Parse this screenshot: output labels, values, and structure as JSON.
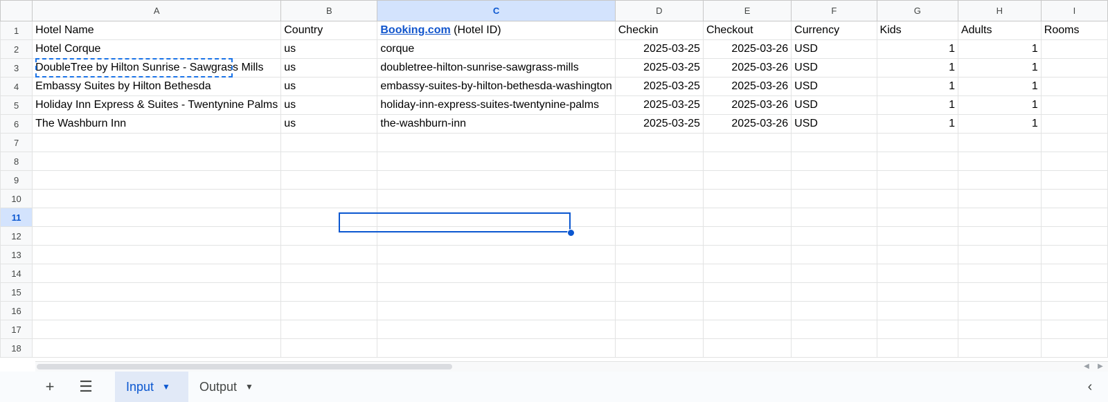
{
  "columns": [
    "A",
    "B",
    "C",
    "D",
    "E",
    "F",
    "G",
    "H",
    "I"
  ],
  "selected_column": "C",
  "selected_row": "11",
  "header": {
    "hotel_name": "Hotel Name",
    "country": "Country",
    "booking_link": "Booking.com",
    "booking_suffix": " (Hotel ID)",
    "checkin": "Checkin",
    "checkout": "Checkout",
    "currency": "Currency",
    "kids": "Kids",
    "adults": "Adults",
    "rooms": "Rooms"
  },
  "rows": [
    {
      "n": "2",
      "name": "Hotel Corque",
      "country": "us",
      "id": "corque",
      "checkin": "2025-03-25",
      "checkout": "2025-03-26",
      "currency": "USD",
      "kids": "1",
      "adults": "1"
    },
    {
      "n": "3",
      "name": "DoubleTree by Hilton Sunrise - Sawgrass Mills",
      "country": "us",
      "id": "doubletree-hilton-sunrise-sawgrass-mills",
      "checkin": "2025-03-25",
      "checkout": "2025-03-26",
      "currency": "USD",
      "kids": "1",
      "adults": "1"
    },
    {
      "n": "4",
      "name": "Embassy Suites by Hilton Bethesda",
      "country": "us",
      "id": "embassy-suites-by-hilton-bethesda-washington",
      "checkin": "2025-03-25",
      "checkout": "2025-03-26",
      "currency": "USD",
      "kids": "1",
      "adults": "1"
    },
    {
      "n": "5",
      "name": "Holiday Inn Express & Suites - Twentynine Palms",
      "country": "us",
      "id": "holiday-inn-express-suites-twentynine-palms",
      "checkin": "2025-03-25",
      "checkout": "2025-03-26",
      "currency": "USD",
      "kids": "1",
      "adults": "1"
    },
    {
      "n": "6",
      "name": "The Washburn Inn",
      "country": "us",
      "id": "the-washburn-inn",
      "checkin": "2025-03-25",
      "checkout": "2025-03-26",
      "currency": "USD",
      "kids": "1",
      "adults": "1"
    }
  ],
  "empty_rows": [
    "7",
    "8",
    "9",
    "10",
    "11",
    "12",
    "13",
    "14",
    "15",
    "16",
    "17",
    "18"
  ],
  "tabs": {
    "add_icon": "plus-icon",
    "menu_icon": "hamburger-menu-icon",
    "sheets": [
      {
        "label": "Input",
        "active": true
      },
      {
        "label": "Output",
        "active": false
      }
    ],
    "collapse_icon": "chevron-left-icon"
  },
  "colors": {
    "accent": "#0b57d0",
    "link": "#1155cc",
    "selection": "#d3e3fd"
  }
}
